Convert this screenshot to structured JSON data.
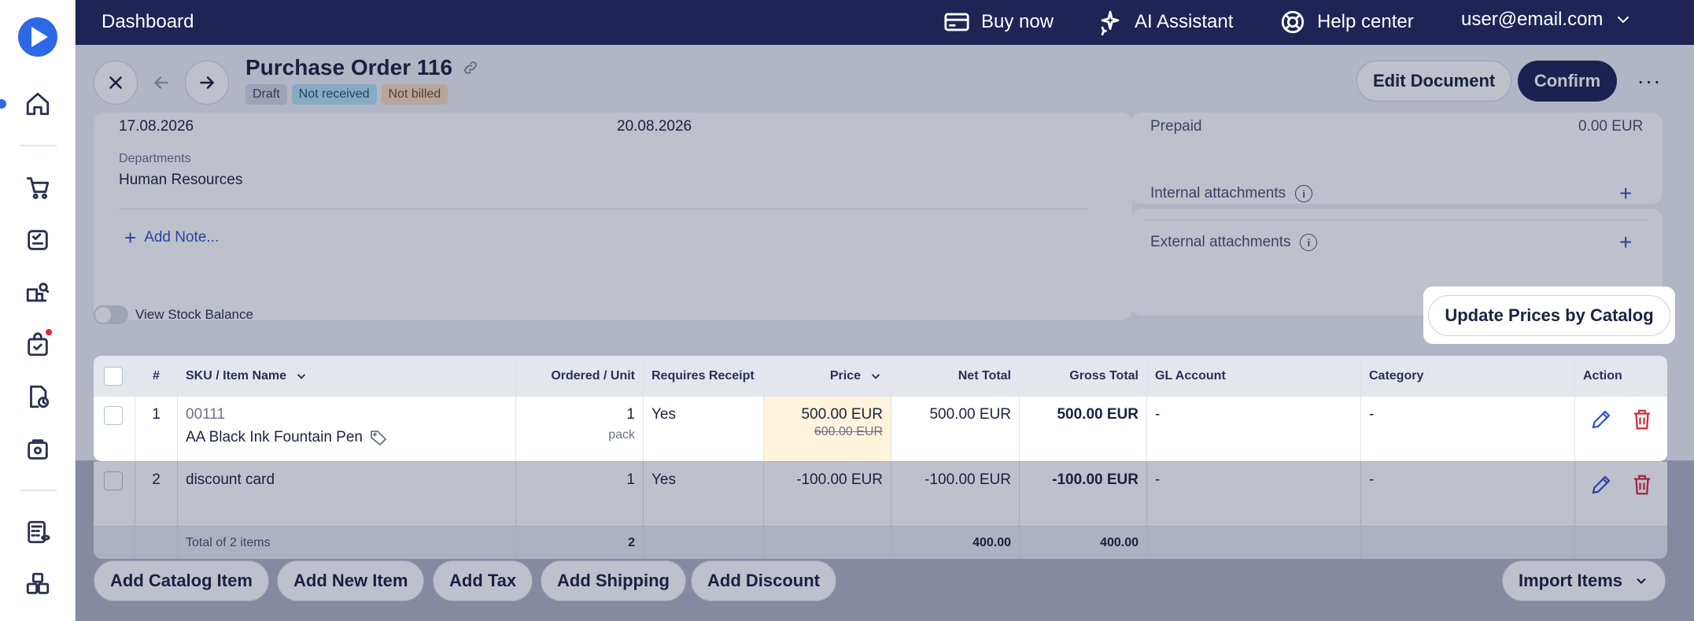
{
  "topbar": {
    "title": "Dashboard",
    "buy_now": "Buy now",
    "ai_assistant": "AI Assistant",
    "help_center": "Help center",
    "user": "user@email.com"
  },
  "header": {
    "title": "Purchase Order 116",
    "tags": {
      "draft": "Draft",
      "not_received": "Not received",
      "not_billed": "Not billed"
    },
    "edit_document": "Edit Document",
    "confirm": "Confirm",
    "more": "···"
  },
  "details": {
    "date1": "17.08.2026",
    "date2": "20.08.2026",
    "departments_label": "Departments",
    "departments_value": "Human Resources",
    "add_note": "Add Note...",
    "prepaid_label": "Prepaid",
    "prepaid_value": "0.00 EUR",
    "internal_attachments": "Internal attachments",
    "external_attachments": "External attachments"
  },
  "stock": {
    "toggle_label": "View Stock Balance"
  },
  "update_prices": "Update Prices by Catalog",
  "table": {
    "headers": {
      "num": "#",
      "sku": "SKU / Item Name",
      "ordered": "Ordered / Unit",
      "requires_receipt": "Requires Receipt",
      "price": "Price",
      "net_total": "Net Total",
      "gross_total": "Gross Total",
      "gl_account": "GL Account",
      "category": "Category",
      "action": "Action"
    },
    "rows": [
      {
        "num": "1",
        "sku": "00111",
        "name": "AA Black Ink Fountain Pen",
        "qty": "1",
        "unit": "pack",
        "requires_receipt": "Yes",
        "price": "500.00 EUR",
        "old_price": "600.00 EUR",
        "net_total": "500.00 EUR",
        "gross_total": "500.00 EUR",
        "gl_account": "-",
        "category": "-"
      },
      {
        "num": "2",
        "name": "discount card",
        "qty": "1",
        "requires_receipt": "Yes",
        "price": "-100.00 EUR",
        "net_total": "-100.00 EUR",
        "gross_total": "-100.00 EUR",
        "gl_account": "-",
        "category": "-"
      }
    ],
    "total": {
      "label": "Total of 2 items",
      "qty": "2",
      "net": "400.00",
      "gross": "400.00"
    }
  },
  "footer": {
    "add_catalog_item": "Add Catalog Item",
    "add_new_item": "Add New Item",
    "add_tax": "Add Tax",
    "add_shipping": "Add Shipping",
    "add_discount": "Add Discount",
    "import_items": "Import Items"
  }
}
